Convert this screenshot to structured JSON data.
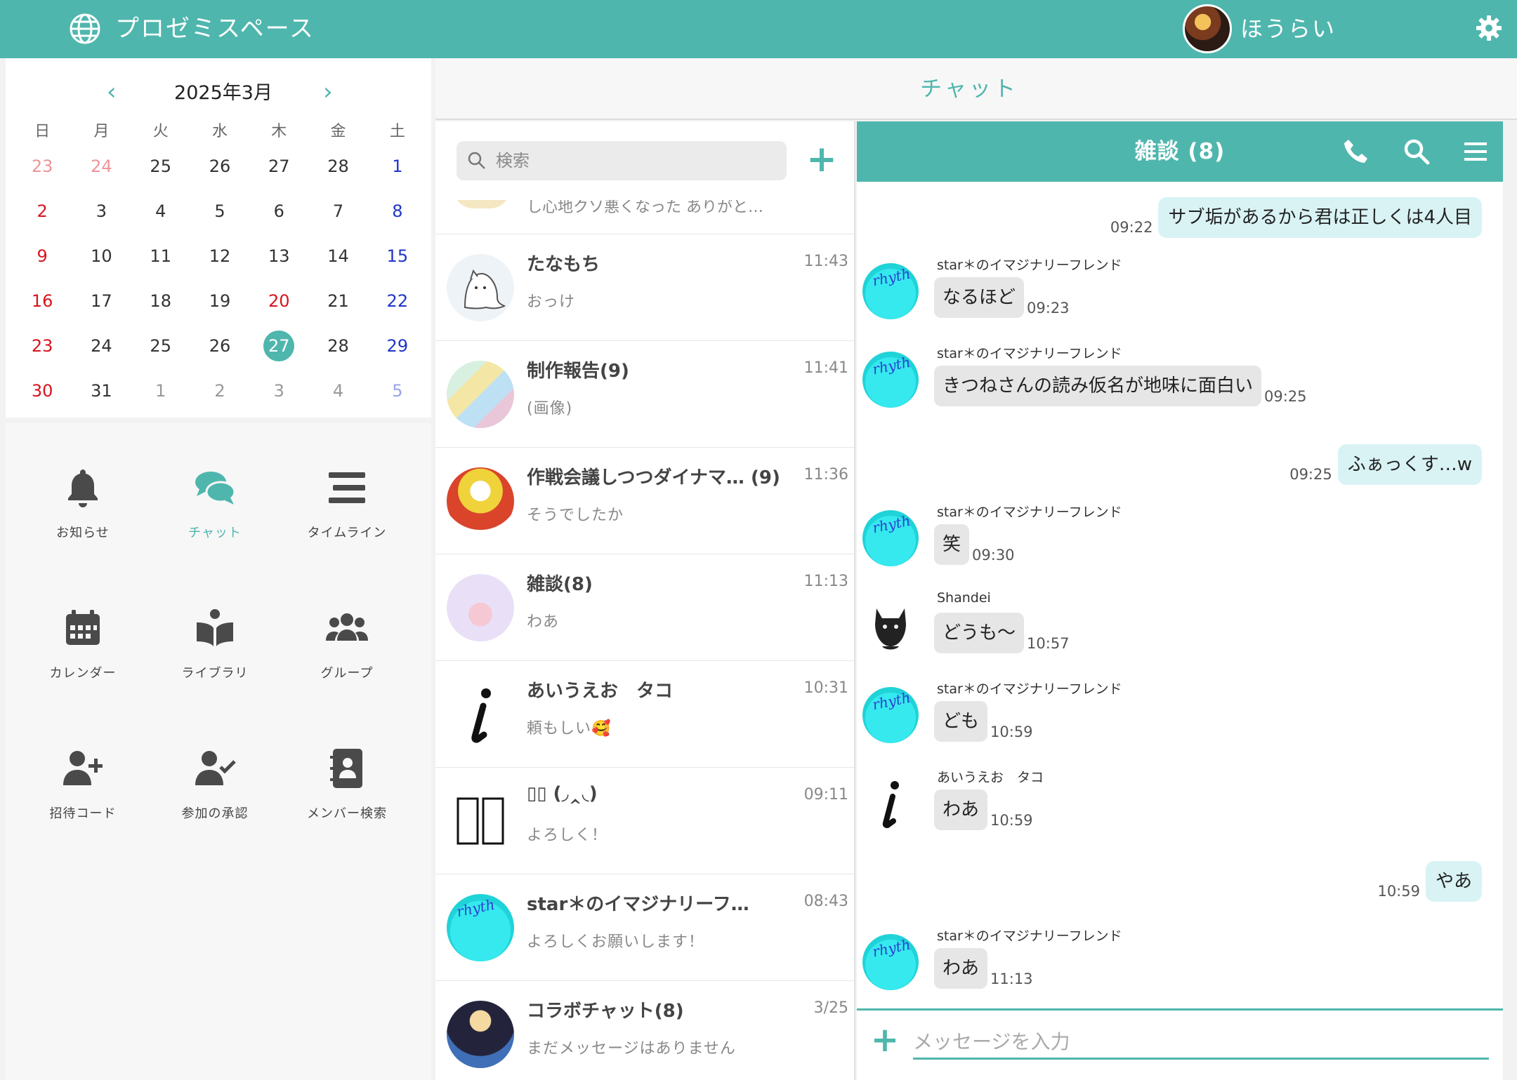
{
  "topbar": {
    "app_title": "プロゼミスペース",
    "user_name": "ほうらい"
  },
  "calendar": {
    "title": "2025年3月",
    "weekdays": [
      "日",
      "月",
      "火",
      "水",
      "木",
      "金",
      "土"
    ],
    "weeks": [
      [
        "23",
        "24",
        "25",
        "26",
        "27",
        "28",
        "1"
      ],
      [
        "2",
        "3",
        "4",
        "5",
        "6",
        "7",
        "8"
      ],
      [
        "9",
        "10",
        "11",
        "12",
        "13",
        "14",
        "15"
      ],
      [
        "16",
        "17",
        "18",
        "19",
        "20",
        "21",
        "22"
      ],
      [
        "23",
        "24",
        "25",
        "26",
        "27",
        "28",
        "29"
      ],
      [
        "30",
        "31",
        "1",
        "2",
        "3",
        "4",
        "5"
      ]
    ],
    "today": "27"
  },
  "menu": {
    "notifications": "お知らせ",
    "chat": "チャット",
    "timeline": "タイムライン",
    "calendar": "カレンダー",
    "library": "ライブラリ",
    "group": "グループ",
    "invite_code": "招待コード",
    "join_approval": "参加の承認",
    "member_search": "メンバー検索"
  },
  "header": {
    "title": "チャット"
  },
  "list": {
    "search_placeholder": "検索",
    "cut_preview": "し心地クソ悪くなった ありがと…",
    "conversations": [
      {
        "name": "たなもち",
        "time": "11:43",
        "preview": "おっけ"
      },
      {
        "name": "制作報告(9)",
        "time": "11:41",
        "preview": "(画像)"
      },
      {
        "name": "作戦会議しつつダイナマ… (9)",
        "time": "11:36",
        "preview": "そうでしたか"
      },
      {
        "name": "雑談(8)",
        "time": "11:13",
        "preview": "わあ"
      },
      {
        "name": "あいうえお　タコ",
        "time": "10:31",
        "preview": "頼もしい🥰"
      },
      {
        "name": "▯▯ (◞‸◟)",
        "time": "09:11",
        "preview": "よろしく！"
      },
      {
        "name": "star＊のイマジナリーフ…",
        "time": "08:43",
        "preview": "よろしくお願いします！"
      },
      {
        "name": "コラボチャット(8)",
        "time": "3/25",
        "preview": "まだメッセージはありません"
      }
    ]
  },
  "chat": {
    "room": "雑談 (8)",
    "messages": [
      {
        "mine": true,
        "text": "サブ垢があるから君は正しくは4人目",
        "time": "09:22"
      },
      {
        "mine": false,
        "sender": "star＊のイマジナリーフレンド",
        "text": "なるほど",
        "time": "09:23"
      },
      {
        "mine": false,
        "sender": "star＊のイマジナリーフレンド",
        "text": "きつねさんの読み仮名が地味に面白い",
        "time": "09:25"
      },
      {
        "mine": true,
        "text": "ふぁっくす…w",
        "time": "09:25"
      },
      {
        "mine": false,
        "sender": "star＊のイマジナリーフレンド",
        "text": "笑",
        "time": "09:30"
      },
      {
        "mine": false,
        "sender": "Shandei",
        "text": "どうも〜",
        "time": "10:57"
      },
      {
        "mine": false,
        "sender": "star＊のイマジナリーフレンド",
        "text": "ども",
        "time": "10:59"
      },
      {
        "mine": false,
        "sender": "あいうえお　タコ",
        "text": "わあ",
        "time": "10:59"
      },
      {
        "mine": true,
        "text": "やあ",
        "time": "10:59"
      },
      {
        "mine": false,
        "sender": "star＊のイマジナリーフレンド",
        "text": "わあ",
        "time": "11:13"
      }
    ],
    "input_placeholder": "メッセージを入力"
  },
  "colors": {
    "accent": "#4fb6ad",
    "sunday": "#d9141e",
    "saturday": "#1f36c9",
    "my_bubble": "#d9f3f5",
    "other_bubble": "#e6e6e6"
  },
  "icons": [
    "globe-icon",
    "gear-icon",
    "bell-icon",
    "chat-bubbles-icon",
    "timeline-icon",
    "calendar-icon",
    "book-icon",
    "group-icon",
    "user-plus-icon",
    "user-check-icon",
    "contact-book-icon",
    "search-icon",
    "plus-icon",
    "phone-icon",
    "hamburger-icon"
  ]
}
